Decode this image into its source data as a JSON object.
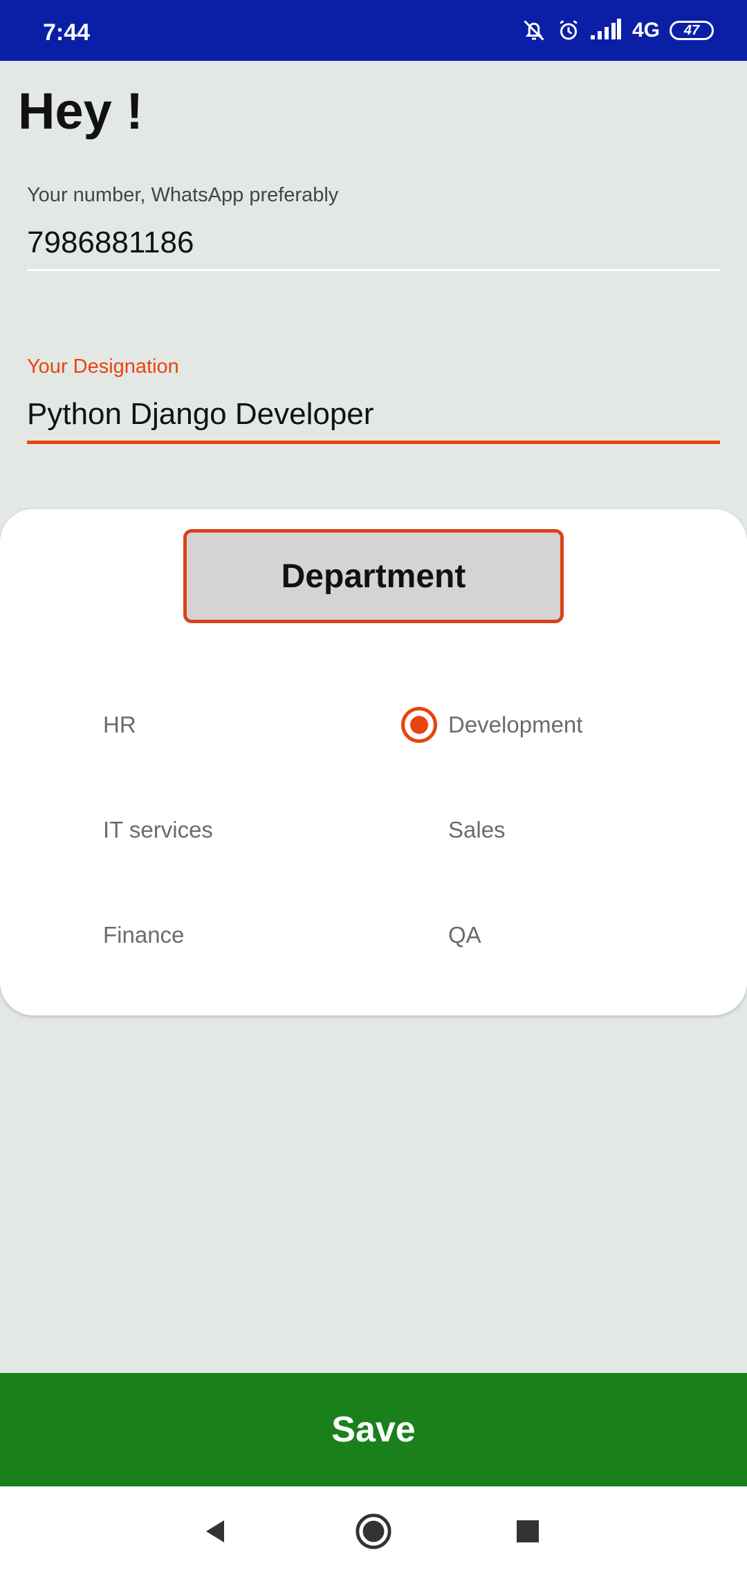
{
  "status_bar": {
    "time": "7:44",
    "network": "4G",
    "battery": "47",
    "icons": [
      "bell-off-icon",
      "alarm-icon",
      "signal-icon",
      "battery-icon"
    ]
  },
  "greeting": "Hey !",
  "phone_field": {
    "label": "Your number, WhatsApp preferably",
    "value": "7986881186"
  },
  "designation_field": {
    "label": "Your Designation",
    "value": "Python Django Developer"
  },
  "department": {
    "button_label": "Department",
    "options": [
      {
        "label": "HR",
        "checked": false
      },
      {
        "label": "Development",
        "checked": true
      },
      {
        "label": "IT services",
        "checked": false
      },
      {
        "label": "Sales",
        "checked": false
      },
      {
        "label": "Finance",
        "checked": false
      },
      {
        "label": "QA",
        "checked": false
      }
    ]
  },
  "save_label": "Save",
  "nav": {
    "icons": [
      "back-icon",
      "home-icon",
      "recents-icon"
    ]
  },
  "colors": {
    "status_bar": "#0b1fa6",
    "accent": "#e8440f",
    "save_button": "#1a801c",
    "background": "#e3e8e5"
  }
}
